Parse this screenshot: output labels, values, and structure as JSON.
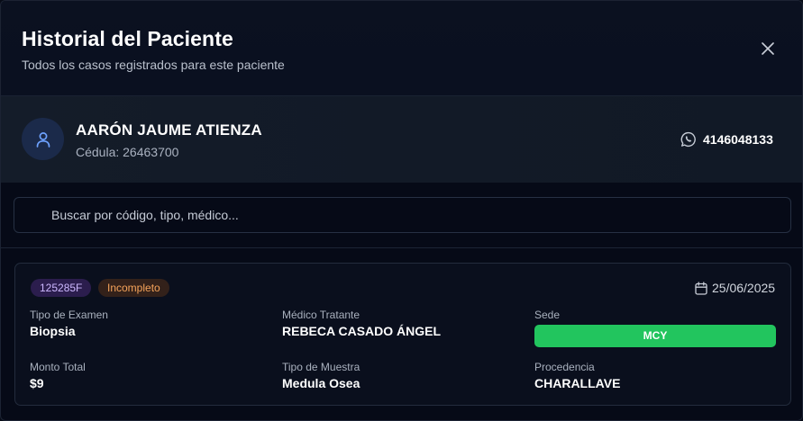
{
  "header": {
    "title": "Historial del Paciente",
    "subtitle": "Todos los casos registrados para este paciente",
    "close_icon": "close-icon"
  },
  "patient": {
    "avatar_icon": "user-icon",
    "name": "AARÓN JAUME ATIENZA",
    "id_text": "Cédula: 26463700",
    "phone_icon": "whatsapp-icon",
    "phone": "4146048133"
  },
  "search": {
    "placeholder": "Buscar por código, tipo, médico...",
    "value": ""
  },
  "cases": [
    {
      "code": "125285F",
      "status": "Incompleto",
      "date_icon": "calendar-icon",
      "date": "25/06/2025",
      "exam_type_label": "Tipo de Examen",
      "exam_type": "Biopsia",
      "doctor_label": "Médico Tratante",
      "doctor": "REBECA CASADO ÁNGEL",
      "site_label": "Sede",
      "site": "MCY",
      "amount_label": "Monto Total",
      "amount": "$9",
      "sample_label": "Tipo de Muestra",
      "sample": "Medula Osea",
      "origin_label": "Procedencia",
      "origin": "CHARALLAVE"
    }
  ],
  "colors": {
    "background": "#060a17",
    "code_badge": "#2b1d4d",
    "status_badge": "#33211a",
    "status_text": "#f5a35a",
    "site_badge": "#22c55e",
    "avatar_bg": "#1b2a4a"
  }
}
